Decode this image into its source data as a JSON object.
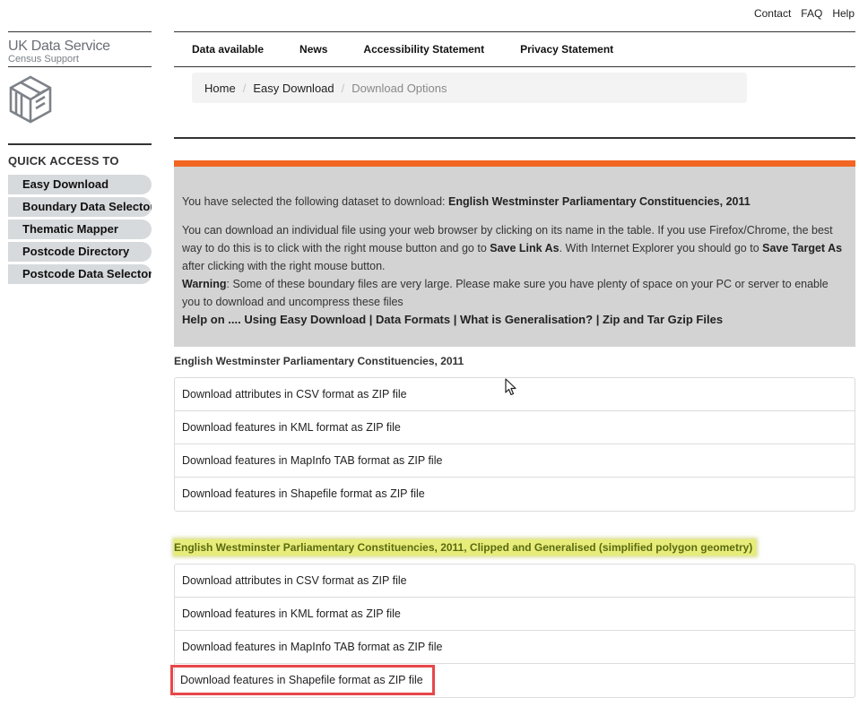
{
  "toplinks": {
    "contact": "Contact",
    "faq": "FAQ",
    "help": "Help"
  },
  "logo": {
    "main": "UK Data Service",
    "sub": "Census Support",
    "icon": "cube-logo-icon"
  },
  "quick_access": {
    "title": "QUICK ACCESS TO",
    "items": [
      {
        "label": "Easy Download"
      },
      {
        "label": "Boundary Data Selector"
      },
      {
        "label": "Thematic Mapper"
      },
      {
        "label": "Postcode Directory"
      },
      {
        "label": "Postcode Data Selector"
      }
    ]
  },
  "nav": {
    "items": [
      {
        "label": "Data available"
      },
      {
        "label": "News"
      },
      {
        "label": "Accessibility Statement"
      },
      {
        "label": "Privacy Statement"
      }
    ]
  },
  "breadcrumb": {
    "home": "Home",
    "easy_download": "Easy Download",
    "current": "Download Options",
    "separator": "/"
  },
  "info": {
    "selected_prefix": "You have selected the following dataset to download: ",
    "selected_dataset": "English Westminster Parliamentary Constituencies, 2011",
    "instr_1": "You can download an individual file using your web browser by clicking on its name in the table. If you use Firefox/Chrome, the best way to do this is to click with the right mouse button and go to ",
    "save_link_as": "Save Link As",
    "instr_2": ". With Internet Explorer you should go to ",
    "save_target_as": "Save Target As",
    "instr_3": " after clicking with the right mouse button.",
    "warning_label": "Warning",
    "warning_text": ": Some of these boundary files are very large. Please make sure you have plenty of space on your PC or server to enable you to download and uncompress these files",
    "help_prefix": "Help on .... ",
    "help_links": {
      "using": "Using Easy Download",
      "formats": "Data Formats",
      "generalisation": "What is Generalisation?",
      "zip": "Zip and Tar Gzip Files"
    },
    "help_sep": " | "
  },
  "sections": [
    {
      "title": "English Westminster Parliamentary Constituencies, 2011",
      "downloads": [
        "Download attributes in CSV format as ZIP file",
        "Download features in KML format as ZIP file",
        "Download features in MapInfo TAB format as ZIP file",
        "Download features in Shapefile format as ZIP file"
      ]
    },
    {
      "title": "English Westminster Parliamentary Constituencies, 2011, Clipped and Generalised (simplified polygon geometry)",
      "downloads": [
        "Download attributes in CSV format as ZIP file",
        "Download features in KML format as ZIP file",
        "Download features in MapInfo TAB format as ZIP file",
        "Download features in Shapefile format as ZIP file"
      ]
    }
  ],
  "colors": {
    "accent_orange": "#f26522",
    "info_bg": "#d3d3d3",
    "quick_item_bg": "#d7dadd",
    "highlight_yellow": "#e7ec7a",
    "highlight_red": "#e8474a"
  }
}
